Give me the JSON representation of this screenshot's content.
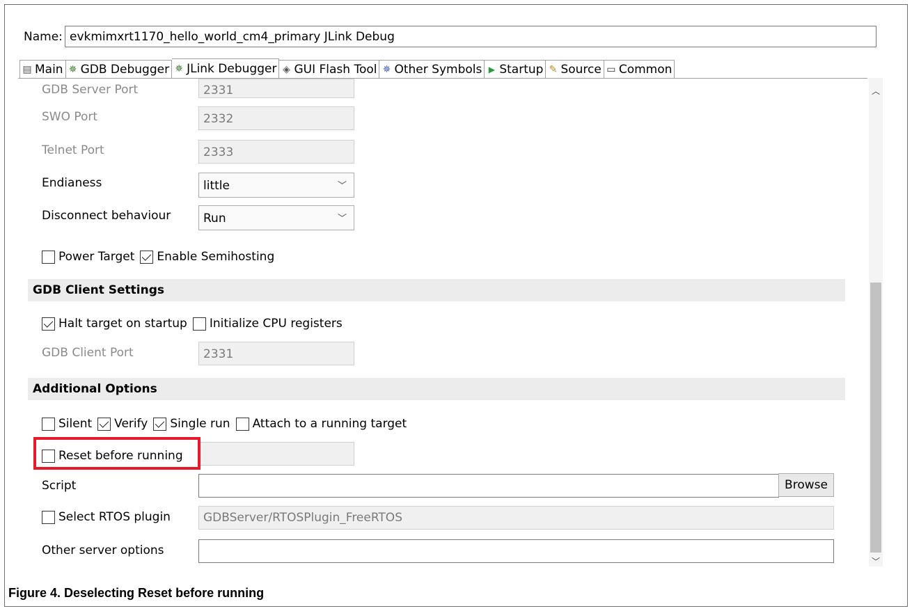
{
  "window": {
    "name_label": "Name:",
    "name_value": "evkmimxrt1170_hello_world_cm4_primary JLink Debug"
  },
  "tabs": [
    {
      "label": "Main",
      "icon": "document-icon"
    },
    {
      "label": "GDB Debugger",
      "icon": "debug-bug-icon"
    },
    {
      "label": "JLink Debugger",
      "icon": "debug-bug-icon"
    },
    {
      "label": "GUI Flash Tool",
      "icon": "flash-tool-icon"
    },
    {
      "label": "Other Symbols",
      "icon": "symbols-icon"
    },
    {
      "label": "Startup",
      "icon": "play-icon"
    },
    {
      "label": "Source",
      "icon": "source-icon"
    },
    {
      "label": "Common",
      "icon": "common-icon"
    }
  ],
  "server": {
    "gdb_server_port_label": "GDB Server Port",
    "gdb_server_port_value": "2331",
    "swo_port_label": "SWO Port",
    "swo_port_value": "2332",
    "telnet_port_label": "Telnet Port",
    "telnet_port_value": "2333",
    "endianess_label": "Endianess",
    "endianess_value": "little",
    "disconnect_label": "Disconnect behaviour",
    "disconnect_value": "Run",
    "power_target_label": "Power Target",
    "enable_semihosting_label": "Enable Semihosting"
  },
  "client": {
    "section_title": "GDB Client Settings",
    "halt_label": "Halt target on startup",
    "init_cpu_label": "Initialize CPU registers",
    "client_port_label": "GDB Client Port",
    "client_port_value": "2331"
  },
  "additional": {
    "section_title": "Additional Options",
    "silent_label": "Silent",
    "verify_label": "Verify",
    "single_run_label": "Single run",
    "attach_label": "Attach to a running target",
    "reset_label": "Reset before running",
    "script_label": "Script",
    "browse_label": "Browse",
    "rtos_label": "Select RTOS plugin",
    "rtos_value": "GDBServer/RTOSPlugin_FreeRTOS",
    "other_options_label": "Other server options"
  },
  "checkbox_states": {
    "power_target": false,
    "enable_semihosting": true,
    "halt_target": true,
    "init_cpu": false,
    "silent": false,
    "verify": true,
    "single_run": true,
    "attach": false,
    "reset_before_running": false,
    "select_rtos": false
  },
  "colors": {
    "highlight_box": "#e51a2b",
    "section_bg": "#ececec"
  },
  "caption": "Figure 4. Deselecting Reset before running"
}
